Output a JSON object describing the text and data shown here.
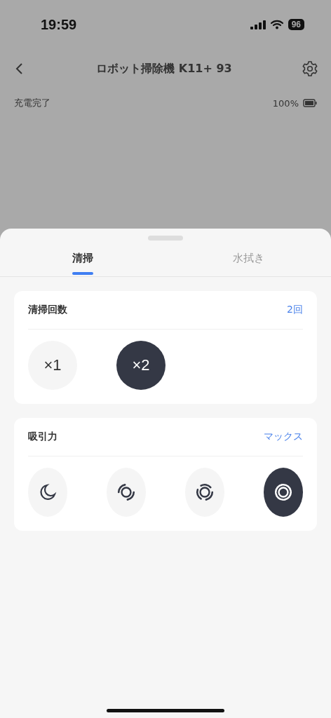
{
  "status_bar": {
    "time": "19:59",
    "battery": "96"
  },
  "header": {
    "title": "ロボット掃除機 K11+ 93"
  },
  "device_status": {
    "state": "充電完了",
    "battery": "100%"
  },
  "tabs": [
    {
      "label": "清掃",
      "selected": true
    },
    {
      "label": "水拭き",
      "selected": false
    }
  ],
  "cards": [
    {
      "title": "清掃回数",
      "value": "2回",
      "options": [
        {
          "kind": "text",
          "label": "×1",
          "selected": false
        },
        {
          "kind": "text",
          "label": "×2",
          "selected": true
        }
      ]
    },
    {
      "title": "吸引力",
      "value": "マックス",
      "options": [
        {
          "kind": "quiet",
          "selected": false
        },
        {
          "kind": "standard",
          "selected": false
        },
        {
          "kind": "turbo",
          "selected": false
        },
        {
          "kind": "max",
          "selected": true
        }
      ]
    }
  ]
}
